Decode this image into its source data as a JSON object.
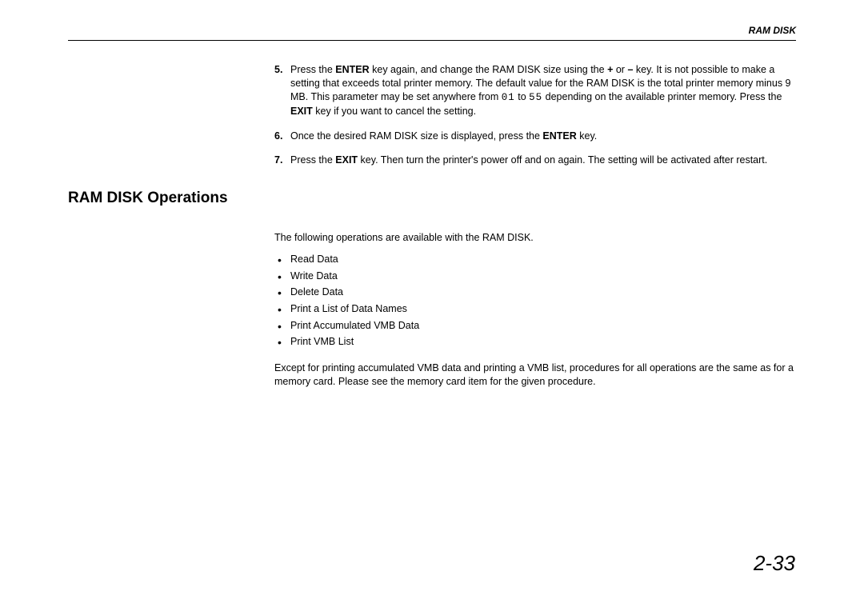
{
  "header": {
    "label": "RAM DISK"
  },
  "steps": {
    "s5": {
      "num": "5.",
      "t1": "Press the ",
      "b1": "ENTER",
      "t2": " key again, and change the RAM DISK size using the ",
      "b2": "+",
      "t3": " or ",
      "b3": "–",
      "t4": " key. It is not possible to make a setting that exceeds total printer memory. The default value for the RAM DISK is the total printer memory minus 9 MB. This parameter may be set anywhere from ",
      "m1": "01",
      "t5": " to ",
      "m2": "55",
      "t6": " depending on the available printer memory. Press the ",
      "b4": "EXIT",
      "t7": " key if you want to cancel the setting."
    },
    "s6": {
      "num": "6.",
      "t1": "Once the desired RAM DISK size is displayed, press the ",
      "b1": "ENTER",
      "t2": " key."
    },
    "s7": {
      "num": "7.",
      "t1": "Press the ",
      "b1": "EXIT",
      "t2": " key. Then turn the printer's power off and on again. The setting will be activated after restart."
    }
  },
  "section": {
    "heading": "RAM DISK Operations",
    "intro": "The following operations are available with the RAM DISK.",
    "bullets": [
      "Read Data",
      "Write Data",
      "Delete Data",
      "Print a List of Data Names",
      "Print Accumulated VMB Data",
      "Print VMB List"
    ],
    "outro": "Except for printing accumulated VMB data and printing a VMB list, procedures for all operations are the same as for a memory card. Please see the memory card item for the given procedure."
  },
  "footer": {
    "page_number": "2-33"
  }
}
